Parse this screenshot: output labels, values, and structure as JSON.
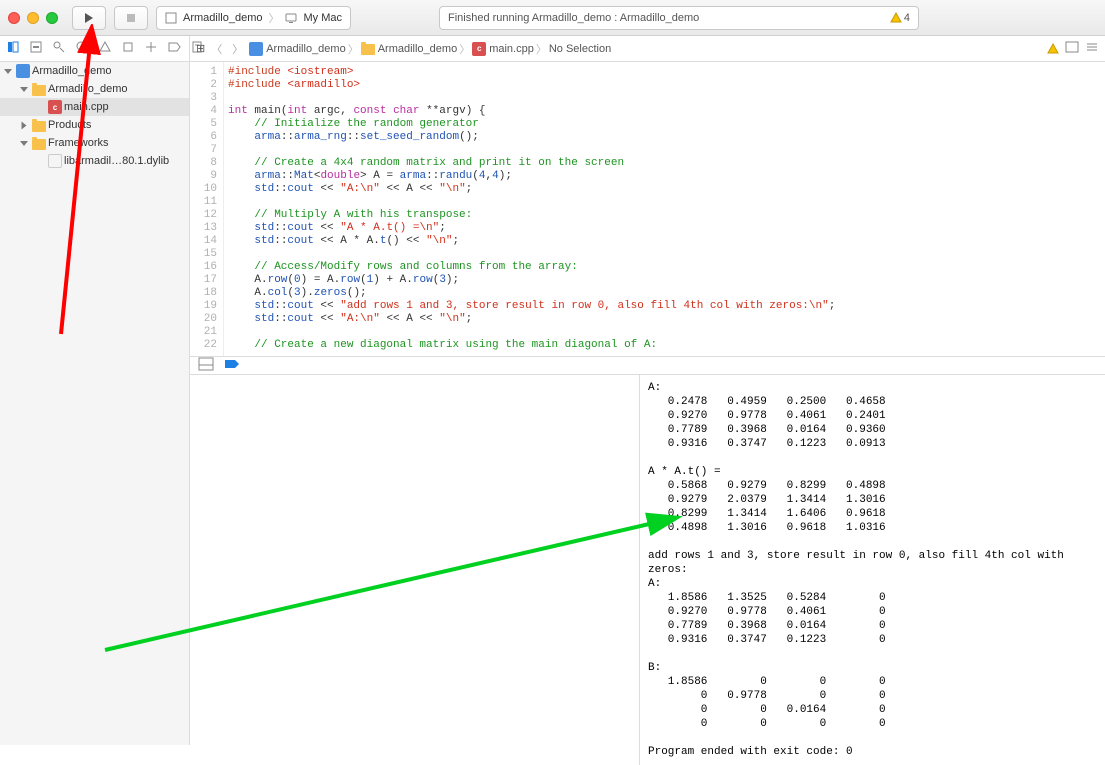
{
  "titlebar": {
    "scheme_project": "Armadillo_demo",
    "scheme_target": "My Mac",
    "status_text": "Finished running Armadillo_demo : Armadillo_demo",
    "warn_count": "4"
  },
  "sidebar": {
    "root": "Armadillo_demo",
    "group1": "Armadillo_demo",
    "file1": "main.cpp",
    "group2": "Products",
    "group3": "Frameworks",
    "lib": "libarmadil…80.1.dylib"
  },
  "jump": {
    "related": "⧉",
    "p1": "Armadillo_demo",
    "p2": "Armadillo_demo",
    "p3": "main.cpp",
    "p4": "No Selection"
  },
  "code": {
    "lines": [
      "1",
      "2",
      "3",
      "4",
      "5",
      "6",
      "7",
      "8",
      "9",
      "10",
      "11",
      "12",
      "13",
      "14",
      "15",
      "16",
      "17",
      "18",
      "19",
      "20",
      "21",
      "22"
    ],
    "l1a": "#include",
    "l1b": "<iostream>",
    "l2a": "#include",
    "l2b": "<armadillo>",
    "l4_int": "int",
    "l4_main": " main(",
    "l4_int2": "int",
    "l4_argc": " argc, ",
    "l4_const": "const",
    "l4_char": " char",
    "l4_rest": " **argv) {",
    "l5": "// Initialize the random generator",
    "l6a": "arma",
    "l6b": "::",
    "l6c": "arma_rng",
    "l6d": "::",
    "l6e": "set_seed_random",
    "l6f": "();",
    "l8": "// Create a 4x4 random matrix and print it on the screen",
    "l9a": "arma",
    "l9b": "::",
    "l9c": "Mat",
    "l9d": "<",
    "l9e": "double",
    "l9f": "> A = ",
    "l9g": "arma",
    "l9h": "::",
    "l9i": "randu",
    "l9j": "(",
    "l9k": "4",
    "l9l": ",",
    "l9m": "4",
    "l9n": ");",
    "l10a": "std",
    "l10b": "::",
    "l10c": "cout",
    "l10d": " << ",
    "l10e": "\"A:\\n\"",
    "l10f": " << A << ",
    "l10g": "\"\\n\"",
    "l10h": ";",
    "l12": "// Multiply A with his transpose:",
    "l13a": "std",
    "l13b": "::",
    "l13c": "cout",
    "l13d": " << ",
    "l13e": "\"A * A.t() =\\n\"",
    "l13f": ";",
    "l14a": "std",
    "l14b": "::",
    "l14c": "cout",
    "l14d": " << A * A.",
    "l14e": "t",
    "l14f": "() << ",
    "l14g": "\"\\n\"",
    "l14h": ";",
    "l16": "// Access/Modify rows and columns from the array:",
    "l17a": "A.",
    "l17b": "row",
    "l17c": "(",
    "l17d1": "0",
    "l17e": ") = A.",
    "l17f": "row",
    "l17g": "(",
    "l17h": "1",
    "l17i": ") + A.",
    "l17j": "row",
    "l17k": "(",
    "l17l": "3",
    "l17m": ");",
    "l18a": "A.",
    "l18b": "col",
    "l18c": "(",
    "l18d": "3",
    "l18e": ").",
    "l18f": "zeros",
    "l18g": "();",
    "l19a": "std",
    "l19b": "::",
    "l19c": "cout",
    "l19d": " << ",
    "l19e": "\"add rows 1 and 3, store result in row 0, also fill 4th col with zeros:\\n\"",
    "l19f": ";",
    "l20a": "std",
    "l20b": "::",
    "l20c": "cout",
    "l20d": " << ",
    "l20e": "\"A:\\n\"",
    "l20f": " << A << ",
    "l20g": "\"\\n\"",
    "l20h": ";",
    "l22": "// Create a new diagonal matrix using the main diagonal of A:"
  },
  "console": {
    "out": "A:\n   0.2478   0.4959   0.2500   0.4658\n   0.9270   0.9778   0.4061   0.2401\n   0.7789   0.3968   0.0164   0.9360\n   0.9316   0.3747   0.1223   0.0913\n\nA * A.t() =\n   0.5868   0.9279   0.8299   0.4898\n   0.9279   2.0379   1.3414   1.3016\n   0.8299   1.3414   1.6406   0.9618\n   0.4898   1.3016   0.9618   1.0316\n\nadd rows 1 and 3, store result in row 0, also fill 4th col with\nzeros:\nA:\n   1.8586   1.3525   0.5284        0\n   0.9270   0.9778   0.4061        0\n   0.7789   0.3968   0.0164        0\n   0.9316   0.3747   0.1223        0\n\nB:\n   1.8586        0        0        0\n        0   0.9778        0        0\n        0        0   0.0164        0\n        0        0        0        0\n\nProgram ended with exit code: 0"
  }
}
